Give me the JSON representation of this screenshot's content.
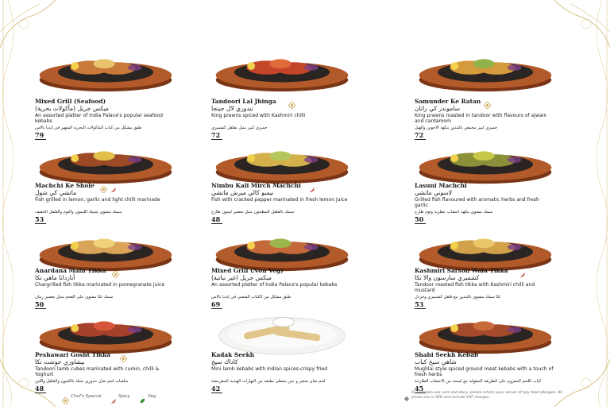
{
  "colors": {
    "wood": "#b25a2a",
    "wood_dark": "#7a3516",
    "gold": "#d6b86a",
    "chilli": "#c0392b",
    "veg": "#3a8f3a"
  },
  "items": [
    {
      "name": "Mixed Grill (Seafood)",
      "name_ar": "ميكس جريل (مأكولات بحرية)",
      "desc": "An assorted platter of India Palace's popular seafood kebabs",
      "desc_ar": "طبق مشكل من كباب المأكولات البحرية الشهير في إنديا بالاس",
      "price": "79",
      "badges": []
    },
    {
      "name": "Tandoori Lal Jhinga",
      "name_ar": "تندوري لال جينجا",
      "desc": "King prawns spiced with Kashmiri chilli",
      "desc_ar": "جمبري كبير متبل بفلفل كشميري",
      "price": "72",
      "badges": [
        "chef"
      ]
    },
    {
      "name": "Samunder Ke Ratan",
      "name_ar": "سامونذر كي راتان",
      "desc": "King prawns roasted in tandoor with flavours of ajwain and cardamom",
      "desc_ar": "جمبري كبير محمص بالتندور بنكهة الأجوين والهيل",
      "price": "72",
      "badges": [
        "chef"
      ]
    },
    {
      "name": "Machchi Ke Shole",
      "name_ar": "ماتشي كي شول",
      "desc": "Fish grilled in lemon, garlic and light chilli marinade",
      "desc_ar": "سمك مشوي بتتبيلة الليمون والثوم والفلفل الخفيف",
      "price": "53",
      "badges": [
        "chef",
        "spicy"
      ]
    },
    {
      "name": "Nimbu Kali Mirch Machchi",
      "name_ar": "نيمبو كالي ميرش ماتشي",
      "desc": "Fish with cracked pepper marinated in fresh lemon  juice",
      "desc_ar": "سمك بالفلفل المطحون متبل بعصير ليمون طازج",
      "price": "48",
      "badges": [
        "spicy"
      ]
    },
    {
      "name": "Lasuni Machchi",
      "name_ar": "لاسوني ماتشي",
      "desc": "Grilled fish flavoured with aromatic herbs and fresh garlic",
      "desc_ar": "سمك مشوي بنكهة أعشاب عطرية وثوم طازج",
      "price": "50",
      "badges": []
    },
    {
      "name": "Anardana Mahi Tikka",
      "name_ar": "أناردانا ماهي تكا",
      "desc": "Chargrilled fish tikka marinated in pomegranate juice",
      "desc_ar": "سمك تكا مشوي على الفحم متبل بعصير رمان",
      "price": "50",
      "badges": [
        "chef"
      ]
    },
    {
      "name": "Mixed Grill (Non Veg)",
      "name_ar": "ميكس جريل (غير نباتية)",
      "desc": "An assorted platter of India Palace's popular kebabs",
      "desc_ar": "طبق مشكل من الكباب الشعبي في إنديا بالاس",
      "price": "69",
      "badges": []
    },
    {
      "name": "Kashmiri Sarson Wala Tikka",
      "name_ar": "كشميري سارسون والا تكا",
      "desc": "Tandoor roasted fish tikka with Kashmiri chilli and mustard",
      "desc_ar": "تكا سمك مشوي بالتندور مع فلفل كشميري وخردل",
      "price": "53",
      "badges": [
        "spicy"
      ]
    },
    {
      "name": "Peshawari Gosht Tikka",
      "name_ar": "بيشاوري جوشت تكا",
      "desc": "Tandoori lamb cubes marinated with cumin, chilli & Yoghurt",
      "desc_ar": "مكعبات لحم ضأن تندوري متبلة بالكمون والفلفل واللبن",
      "price": "48",
      "badges": [
        "chef"
      ]
    },
    {
      "name": "Kadak Seekh",
      "name_ar": "كاداك سيخ",
      "desc": "Mini lamb kebabs with Indian spices-crispy fried",
      "desc_ar": "لحم ضأن صغير و جبن مغطى بطبقة من البهارات الهندية المقرمشة",
      "price": "42",
      "badges": []
    },
    {
      "name": "Shahi Seekh Kebab",
      "name_ar": "شاهي سيخ كباب",
      "desc": "Mughlai style spiced ground meat kebabs with a touch of fresh herbs",
      "desc_ar": "كباب اللحم المفروم على الطريقة المغولية مع لمسة من الأعشاب الطازجة",
      "price": "45",
      "badges": []
    }
  ],
  "legend": {
    "chef": "Chef's Special",
    "spicy": "Spicy",
    "veg": "Veg"
  },
  "note": "Our kitchen use nuts and dairy, please inform your server of any food allergies. All prices are in AED and include VAT charges."
}
